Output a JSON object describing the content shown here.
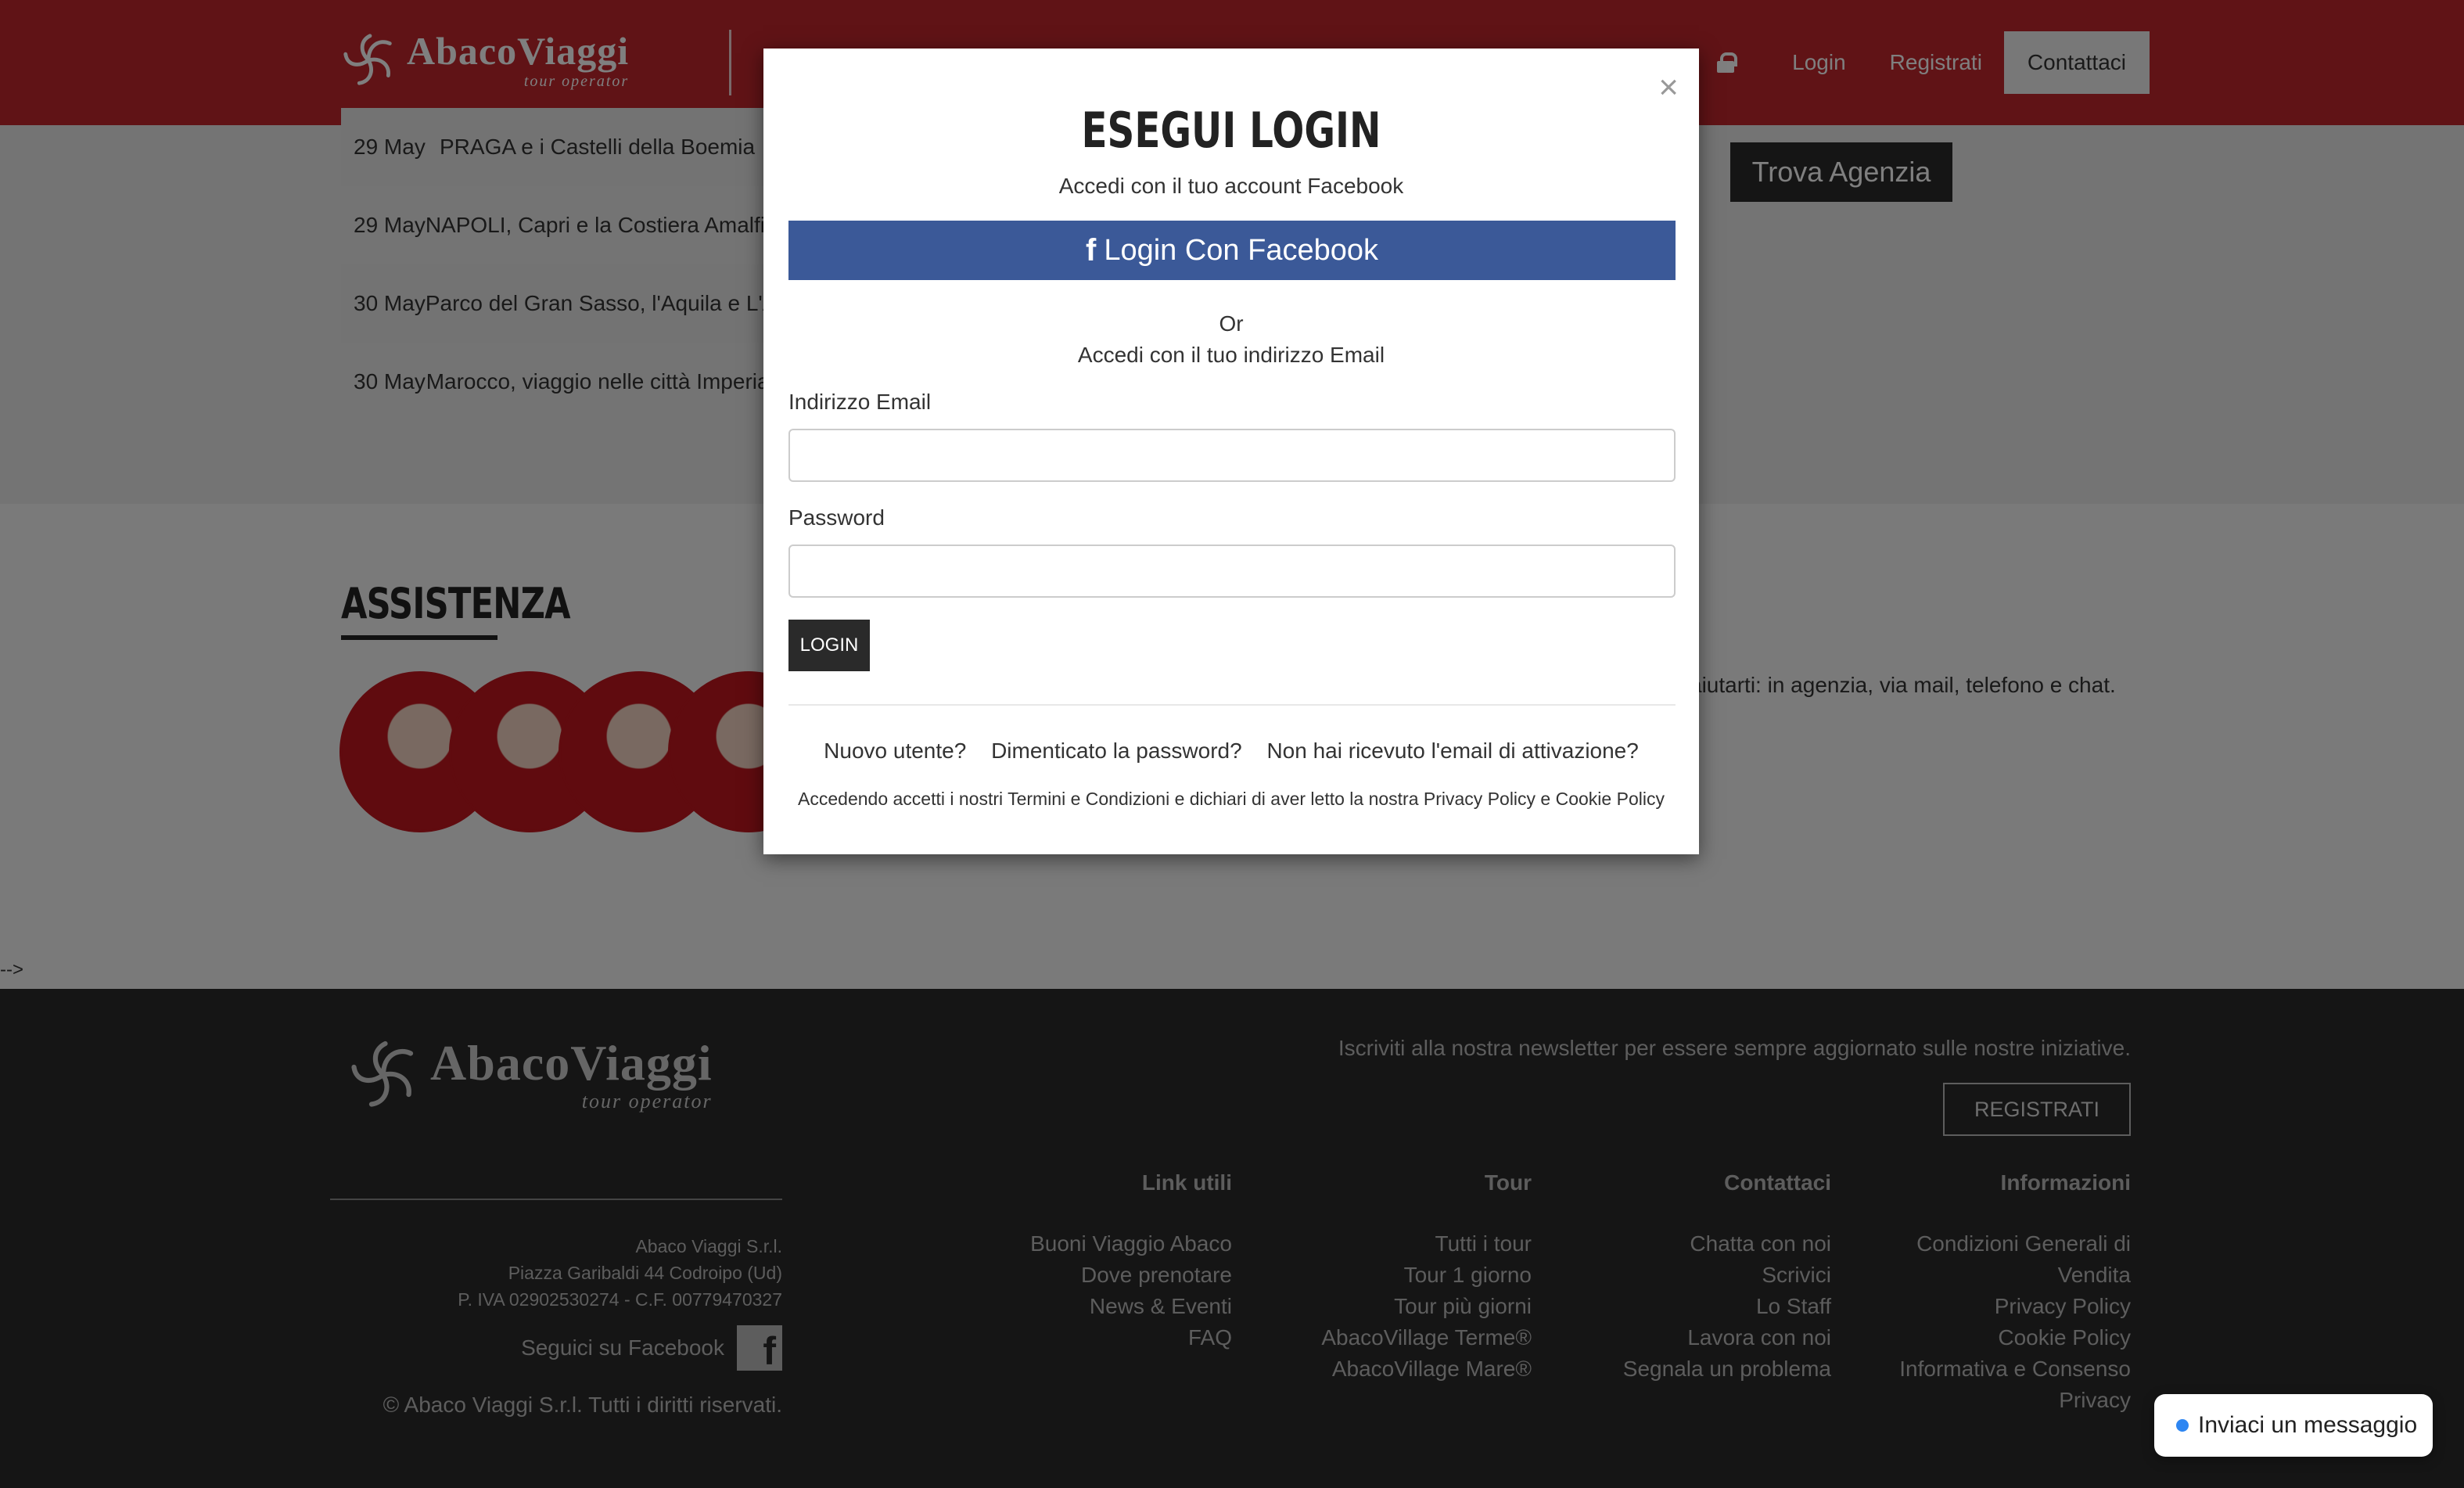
{
  "header": {
    "logo": {
      "brand": "AbacoViaggi",
      "tagline": "tour operator"
    },
    "nav": {
      "login": "Login",
      "register": "Registrati",
      "contact": "Contattaci"
    }
  },
  "tours": [
    {
      "date": "29 May",
      "title": "PRAGA e i Castelli della Boemia"
    },
    {
      "date": "29 May",
      "title": "NAPOLI, Capri e la Costiera Amalfitana"
    },
    {
      "date": "30 May",
      "title": "Parco del Gran Sasso, l'Aquila e L'Abruzzo"
    },
    {
      "date": "30 May",
      "title": "Marocco, viaggio nelle città Imperiali"
    }
  ],
  "find_agency": "Trova Agenzia",
  "assistance": {
    "title": "ASSISTENZA",
    "text_visible": "aiutarti: in agenzia, via mail, telefono e chat."
  },
  "comment_residue": "-->",
  "modal": {
    "title": "ESEGUI LOGIN",
    "fb_subtitle": "Accedi con il tuo account Facebook",
    "fb_button": "Login Con Facebook",
    "or": "Or",
    "email_subtitle": "Accedi con il tuo indirizzo Email",
    "email_label": "Indirizzo Email",
    "email_value": "",
    "password_label": "Password",
    "password_value": "",
    "login_button": "LOGIN",
    "links": {
      "new_user": "Nuovo utente?",
      "forgot": "Dimenticato la password?",
      "no_activation": "Non hai ricevuto l'email di attivazione?"
    },
    "terms": "Accedendo accetti i nostri Termini e Condizioni e dichiari di aver letto la nostra Privacy Policy e Cookie Policy",
    "close": "×"
  },
  "footer": {
    "logo": {
      "brand": "AbacoViaggi",
      "tagline": "tour operator"
    },
    "company": {
      "name": "Abaco Viaggi S.r.l.",
      "address": "Piazza Garibaldi 44 Codroipo (Ud)",
      "vat": "P. IVA 02902530274 - C.F. 00779470327"
    },
    "follow_facebook": "Seguici su Facebook",
    "copyright": "© Abaco Viaggi S.r.l. Tutti i diritti riservati.",
    "newsletter": "Iscriviti alla nostra newsletter per essere sempre aggiornato sulle nostre iniziative.",
    "newsletter_button": "REGISTRATI",
    "columns": [
      {
        "heading": "Link utili",
        "links": [
          "Buoni Viaggio Abaco",
          "Dove prenotare",
          "News & Eventi",
          "FAQ"
        ]
      },
      {
        "heading": "Tour",
        "links": [
          "Tutti i tour",
          "Tour 1 giorno",
          "Tour più giorni",
          "AbacoVillage Terme®",
          "AbacoVillage Mare®"
        ]
      },
      {
        "heading": "Contattaci",
        "links": [
          "Chatta con noi",
          "Scrivici",
          "Lo Staff",
          "Lavora con noi",
          "Segnala un problema"
        ]
      },
      {
        "heading": "Informazioni",
        "links": [
          "Condizioni Generali di Vendita",
          "Privacy Policy",
          "Cookie Policy",
          "Informativa e Consenso Privacy"
        ]
      }
    ]
  },
  "chat_widget": "Inviaci un messaggio",
  "colors": {
    "header_red": "#c1272d",
    "facebook_blue": "#3b5998",
    "footer_bg": "#2a2a2a",
    "chat_dot": "#2e86f2"
  }
}
